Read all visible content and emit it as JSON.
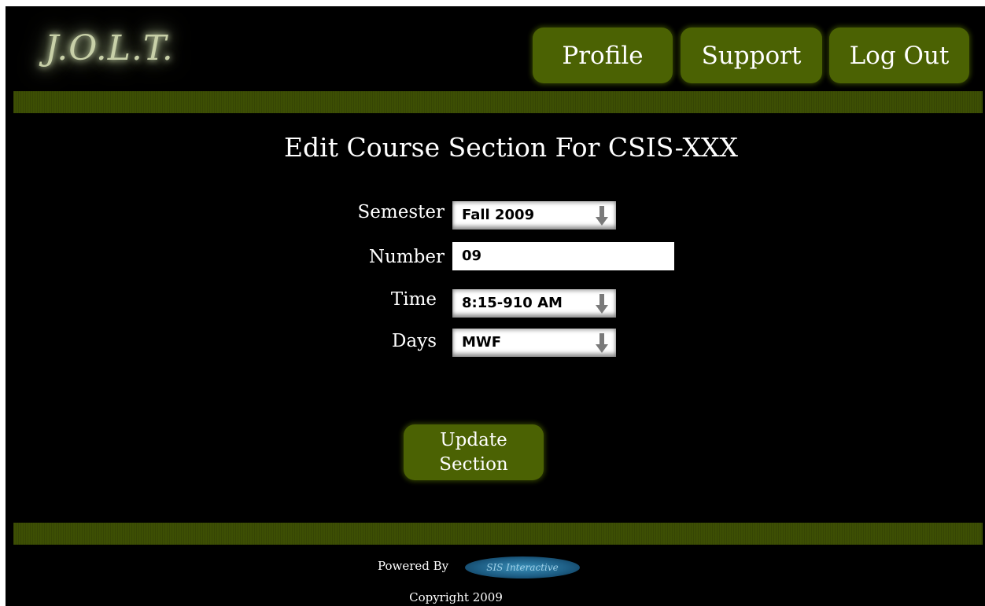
{
  "app": {
    "logo_text": "J.O.L.T."
  },
  "nav": {
    "profile_label": "Profile",
    "support_label": "Support",
    "logout_label": "Log Out"
  },
  "page": {
    "title": "Edit Course Section For CSIS-XXX"
  },
  "form": {
    "semester": {
      "label": "Semester",
      "value": "Fall 2009"
    },
    "number": {
      "label": "Number",
      "value": "09"
    },
    "time": {
      "label": "Time",
      "value": "8:15-910 AM"
    },
    "days": {
      "label": "Days",
      "value": "MWF"
    },
    "submit_label": "Update\nSection"
  },
  "footer": {
    "powered_by": "Powered By",
    "brand_logo_text": "SIS Interactive",
    "copyright": "Copyright 2009"
  },
  "colors": {
    "background": "#000000",
    "accent_green": "#4b6203",
    "bar_green": "#3d4f04",
    "logo_glow": "#c8d0a8"
  },
  "icons": {
    "dropdown": "arrow-down-icon",
    "logo": "sis-interactive-logo"
  }
}
